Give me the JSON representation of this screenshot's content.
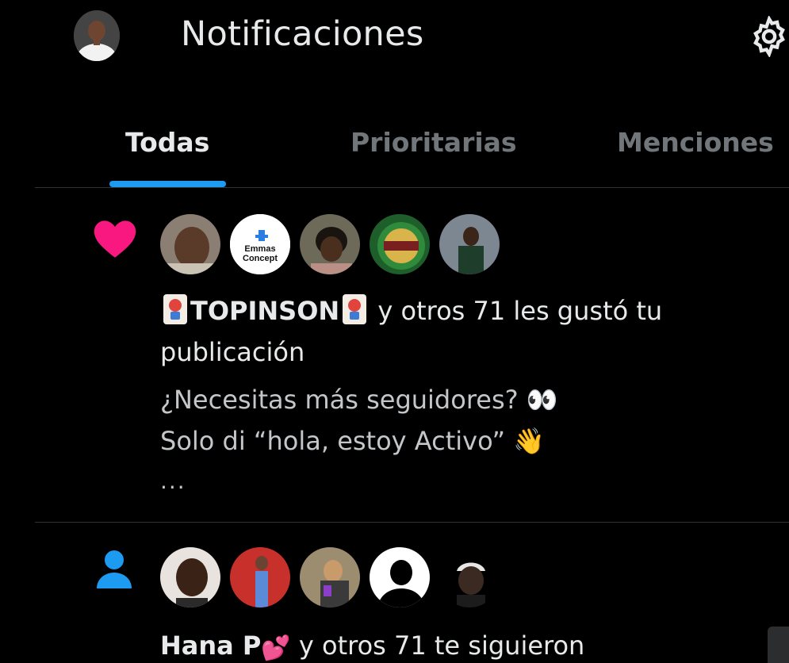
{
  "header": {
    "title": "Notificaciones",
    "avatar_icon": "profile-avatar",
    "settings_icon": "gear-icon"
  },
  "tabs": [
    {
      "label": "Todas",
      "active": true
    },
    {
      "label": "Prioritarias",
      "active": false
    },
    {
      "label": "Menciones",
      "active": false
    }
  ],
  "colors": {
    "background": "#000000",
    "accent": "#1d9bf0",
    "like": "#f91880",
    "text_primary": "#e7e9ea",
    "text_secondary": "#71767b"
  },
  "notifications": [
    {
      "type": "like",
      "icon": "heart-icon",
      "avatars": [
        "user-avatar-1",
        "emmas-concept-avatar",
        "user-avatar-3",
        "group-logo-avatar",
        "user-avatar-5"
      ],
      "name": "TOPINSON",
      "name_emoji": "joker-card-emoji",
      "action": " y otros 71 les gustó tu publicación",
      "preview_line1": "¿Necesitas más seguidores? 👀",
      "preview_line2": "Solo di “hola, estoy Activo” 👋",
      "more": "..."
    },
    {
      "type": "follow",
      "icon": "person-icon",
      "avatars": [
        "user-avatar-6",
        "user-avatar-7",
        "user-avatar-8",
        "default-avatar",
        "user-avatar-10"
      ],
      "name": "Hana P",
      "name_emoji": "💕",
      "action": " y otros 71 te siguieron"
    }
  ],
  "avatar_labels": {
    "emmas_concept": "Emmas Concept"
  }
}
